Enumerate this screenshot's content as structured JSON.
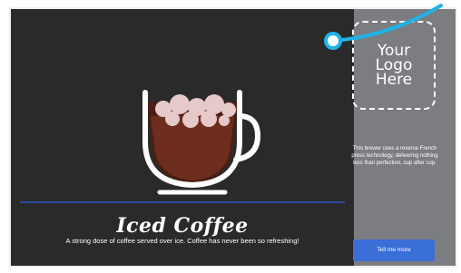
{
  "product": {
    "title": "Iced Coffee",
    "description": "A strong dose of coffee served over ice. Coffee has never been so refreshing!"
  },
  "sidebar": {
    "logo_placeholder": [
      "Your",
      "Logo",
      "Here"
    ],
    "blurb": "This brewer uses a reverse French press technology, delivering nothing less than perfection, cup after cup.",
    "cta_label": "Tell me more"
  },
  "colors": {
    "accent": "#3a6fd8",
    "callout": "#1fb3e6",
    "sidebar_bg": "#7b7d81",
    "main_bg": "#2a2a2a"
  },
  "icons": {
    "product_image": "iced-coffee-cup-icon",
    "callout": "callout-dot-icon"
  }
}
